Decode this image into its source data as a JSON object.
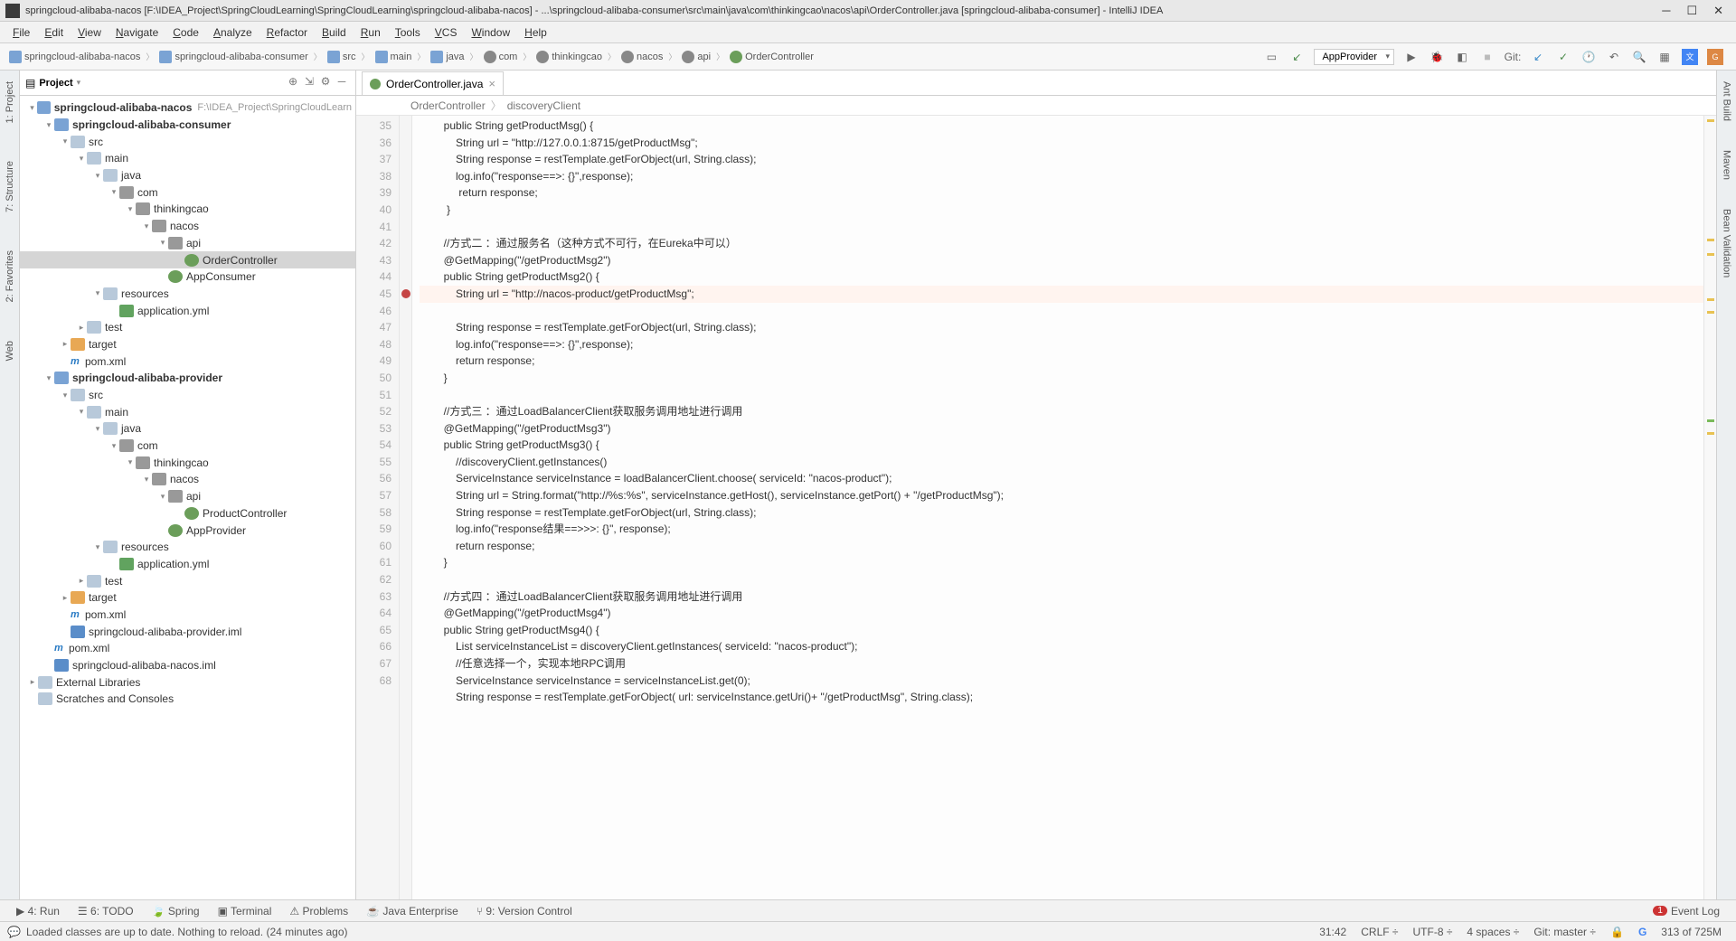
{
  "title": "springcloud-alibaba-nacos [F:\\IDEA_Project\\SpringCloudLearning\\SpringCloudLearning\\springcloud-alibaba-nacos] - ...\\springcloud-alibaba-consumer\\src\\main\\java\\com\\thinkingcao\\nacos\\api\\OrderController.java [springcloud-alibaba-consumer] - IntelliJ IDEA",
  "menu": [
    "File",
    "Edit",
    "View",
    "Navigate",
    "Code",
    "Analyze",
    "Refactor",
    "Build",
    "Run",
    "Tools",
    "VCS",
    "Window",
    "Help"
  ],
  "nav": [
    "springcloud-alibaba-nacos",
    "springcloud-alibaba-consumer",
    "src",
    "main",
    "java",
    "com",
    "thinkingcao",
    "nacos",
    "api",
    "OrderController"
  ],
  "runConfig": "AppProvider",
  "gitLabel": "Git:",
  "projectLabel": "Project",
  "leftTabs": [
    "1: Project",
    "7: Structure",
    "2: Favorites",
    "Web"
  ],
  "rightTabs": [
    "Ant Build",
    "Maven",
    "Bean Validation"
  ],
  "tree": [
    {
      "d": 0,
      "a": "▾",
      "i": "mod",
      "t": "springcloud-alibaba-nacos",
      "b": 1,
      "loc": "F:\\IDEA_Project\\SpringCloudLearn"
    },
    {
      "d": 1,
      "a": "▾",
      "i": "mod",
      "t": "springcloud-alibaba-consumer",
      "b": 1
    },
    {
      "d": 2,
      "a": "▾",
      "i": "dir",
      "t": "src"
    },
    {
      "d": 3,
      "a": "▾",
      "i": "dir",
      "t": "main"
    },
    {
      "d": 4,
      "a": "▾",
      "i": "dir",
      "t": "java"
    },
    {
      "d": 5,
      "a": "▾",
      "i": "pkg",
      "t": "com"
    },
    {
      "d": 6,
      "a": "▾",
      "i": "pkg",
      "t": "thinkingcao"
    },
    {
      "d": 7,
      "a": "▾",
      "i": "pkg",
      "t": "nacos"
    },
    {
      "d": 8,
      "a": "▾",
      "i": "pkg",
      "t": "api"
    },
    {
      "d": 9,
      "a": "",
      "i": "class",
      "t": "OrderController",
      "sel": 1
    },
    {
      "d": 8,
      "a": "",
      "i": "class",
      "t": "AppConsumer"
    },
    {
      "d": 4,
      "a": "▾",
      "i": "dir",
      "t": "resources"
    },
    {
      "d": 5,
      "a": "",
      "i": "yml",
      "t": "application.yml"
    },
    {
      "d": 3,
      "a": "▸",
      "i": "dir",
      "t": "test"
    },
    {
      "d": 2,
      "a": "▸",
      "i": "dir-o",
      "t": "target"
    },
    {
      "d": 2,
      "a": "",
      "i": "mvn",
      "t": "pom.xml"
    },
    {
      "d": 1,
      "a": "▾",
      "i": "mod",
      "t": "springcloud-alibaba-provider",
      "b": 1
    },
    {
      "d": 2,
      "a": "▾",
      "i": "dir",
      "t": "src"
    },
    {
      "d": 3,
      "a": "▾",
      "i": "dir",
      "t": "main"
    },
    {
      "d": 4,
      "a": "▾",
      "i": "dir",
      "t": "java"
    },
    {
      "d": 5,
      "a": "▾",
      "i": "pkg",
      "t": "com"
    },
    {
      "d": 6,
      "a": "▾",
      "i": "pkg",
      "t": "thinkingcao"
    },
    {
      "d": 7,
      "a": "▾",
      "i": "pkg",
      "t": "nacos"
    },
    {
      "d": 8,
      "a": "▾",
      "i": "pkg",
      "t": "api"
    },
    {
      "d": 9,
      "a": "",
      "i": "class",
      "t": "ProductController"
    },
    {
      "d": 8,
      "a": "",
      "i": "class",
      "t": "AppProvider"
    },
    {
      "d": 4,
      "a": "▾",
      "i": "dir",
      "t": "resources"
    },
    {
      "d": 5,
      "a": "",
      "i": "yml",
      "t": "application.yml"
    },
    {
      "d": 3,
      "a": "▸",
      "i": "dir",
      "t": "test"
    },
    {
      "d": 2,
      "a": "▸",
      "i": "dir-o",
      "t": "target"
    },
    {
      "d": 2,
      "a": "",
      "i": "mvn",
      "t": "pom.xml"
    },
    {
      "d": 2,
      "a": "",
      "i": "iml",
      "t": "springcloud-alibaba-provider.iml"
    },
    {
      "d": 1,
      "a": "",
      "i": "mvn",
      "t": "pom.xml"
    },
    {
      "d": 1,
      "a": "",
      "i": "iml",
      "t": "springcloud-alibaba-nacos.iml"
    },
    {
      "d": 0,
      "a": "▸",
      "i": "lib",
      "t": "External Libraries"
    },
    {
      "d": 0,
      "a": "",
      "i": "scr",
      "t": "Scratches and Consoles"
    }
  ],
  "editorTab": "OrderController.java",
  "breadcrumb": [
    "OrderController",
    "discoveryClient"
  ],
  "code": {
    "start": 35,
    "breakpoint": 45,
    "lines": [
      "        <kw>public</kw> String getProductMsg() {",
      "            String url = <str>\"http://127.0.0.1:8715/getProductMsg\"</str>;",
      "            String response = <fld>restTemplate</fld>.getForObject(url, String.<kw>class</kw>);",
      "            <fld>log</fld>.info(<str>\"response==>: {}\"</str>,response);",
      "             <kw>return</kw> response;",
      "         }",
      "",
      "        <cm>//方式二 ：通过服务名（这种方式不可行，在Eureka中可以）</cm>",
      "        <ann>@GetMapping</ann>(<str>\"/getProductMsg2\"</str>)",
      "        <kw>public</kw> String getProductMsg2() {",
      "            String url = <str>\"http://nacos-product/getProductMsg\"</str>;",
      "            String response = <fld>restTemplate</fld>.getForObject(url, String.<kw>class</kw>);",
      "            <fld>log</fld>.info(<str>\"response==>: {}\"</str>,response);",
      "            <kw>return</kw> response;",
      "        }",
      "",
      "        <cm>//方式三 ：通过LoadBalancerClient获取服务调用地址进行调用</cm>",
      "        <ann>@GetMapping</ann>(<str>\"/getProductMsg3\"</str>)",
      "        <kw>public</kw> String getProductMsg3() {",
      "            <cm>//discoveryClient.getInstances()</cm>",
      "            ServiceInstance serviceInstance = <fld>loadBalancerClient</fld>.choose( <param>serviceId:</param> <str>\"nacos-product\"</str>);",
      "            String url = String.<fld>format</fld>(<str>\"http://%s:%s\"</str>, serviceInstance.getHost(), serviceInstance.getPort() + <str>\"/getProductMsg\"</str>);",
      "            String response = <fld>restTemplate</fld>.getForObject(url, String.<kw>class</kw>);",
      "            <fld>log</fld>.info(<str>\"response结果==>>>: {}\"</str>, response);",
      "            <kw>return</kw> response;",
      "        }",
      "",
      "        <cm>//方式四 ：通过LoadBalancerClient获取服务调用地址进行调用</cm>",
      "        <ann>@GetMapping</ann>(<str>\"/getProductMsg4\"</str>)",
      "        <kw>public</kw> String getProductMsg4() {",
      "            List<ServiceInstance> serviceInstanceList = <hilite><fld>discoveryClient</fld></hilite>.getInstances( <param>serviceId:</param> <str>\"nacos-product\"</str>);",
      "            <cm>//任意选择一个，实现本地RPC调用</cm>",
      "            ServiceInstance serviceInstance = serviceInstanceList.get(0);",
      "            String response = <fld>restTemplate</fld>.getForObject( <param>url:</param> serviceInstance.getUri()+ <str>\"/getProductMsg\"</str>, String.<kw>class</kw>);"
    ]
  },
  "bottomTabs": [
    "▶ 4: Run",
    "☰ 6: TODO",
    "🍃 Spring",
    "▣ Terminal",
    "⚠ Problems",
    "☕ Java Enterprise",
    "⑂ 9: Version Control"
  ],
  "eventLog": "Event Log",
  "eventBadge": "1",
  "status": {
    "msg": "Loaded classes are up to date. Nothing to reload. (24 minutes ago)",
    "pos": "31:42",
    "eol": "CRLF",
    "enc": "UTF-8",
    "indent": "4 spaces",
    "git": "Git: master",
    "mem": "313 of 725M"
  }
}
